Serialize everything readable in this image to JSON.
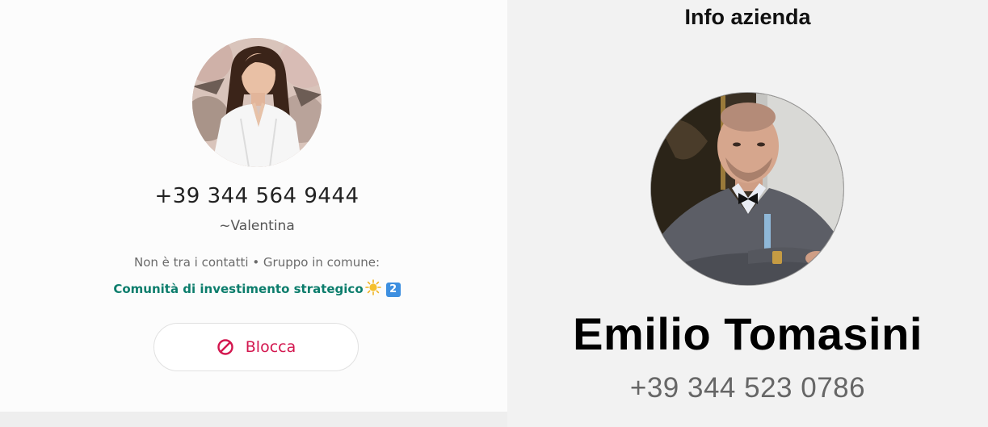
{
  "left_contact": {
    "avatar": {
      "icon": "contact-photo-woman",
      "alt": ""
    },
    "phone": "+39 344 564 9444",
    "name": "~Valentina",
    "meta": "Non è tra i contatti • Gruppo in comune:",
    "group": {
      "name": "Comunità di investimento strategico",
      "emoji_icon": "sun-icon",
      "badge": "2",
      "color": "#0c7d6c"
    },
    "block_button": {
      "label": "Blocca",
      "icon": "block-icon",
      "color": "#d3174f"
    }
  },
  "right_contact": {
    "title": "Info azienda",
    "avatar": {
      "icon": "contact-photo-man"
    },
    "name": "Emilio Tomasini",
    "phone": "+39 344 523 0786"
  }
}
